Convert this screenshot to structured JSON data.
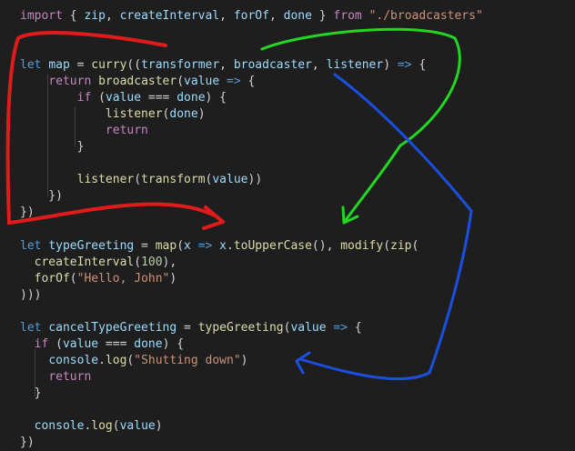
{
  "editor": {
    "theme_colors": {
      "background": "#1e1e1e",
      "keyword": "#569cd6",
      "control": "#c586c0",
      "function": "#dcdcaa",
      "variable": "#9cdcfe",
      "string": "#ce9178",
      "number": "#b5cea8",
      "punctuation": "#d4d4d4"
    },
    "lines": [
      {
        "tokens": [
          {
            "t": "import",
            "c": "ctl"
          },
          {
            "t": " { ",
            "c": "pun"
          },
          {
            "t": "zip",
            "c": "var"
          },
          {
            "t": ", ",
            "c": "pun"
          },
          {
            "t": "createInterval",
            "c": "var"
          },
          {
            "t": ", ",
            "c": "pun"
          },
          {
            "t": "forOf",
            "c": "var"
          },
          {
            "t": ", ",
            "c": "pun"
          },
          {
            "t": "done",
            "c": "var"
          },
          {
            "t": " } ",
            "c": "pun"
          },
          {
            "t": "from",
            "c": "ctl"
          },
          {
            "t": " ",
            "c": "pun"
          },
          {
            "t": "\"./broadcasters\"",
            "c": "str"
          }
        ]
      },
      {
        "tokens": []
      },
      {
        "tokens": []
      },
      {
        "tokens": [
          {
            "t": "let",
            "c": "kw"
          },
          {
            "t": " ",
            "c": "pun"
          },
          {
            "t": "map",
            "c": "var"
          },
          {
            "t": " = ",
            "c": "pun"
          },
          {
            "t": "curry",
            "c": "fn"
          },
          {
            "t": "((",
            "c": "pun"
          },
          {
            "t": "transformer",
            "c": "var"
          },
          {
            "t": ", ",
            "c": "pun"
          },
          {
            "t": "broadcaster",
            "c": "var"
          },
          {
            "t": ", ",
            "c": "pun"
          },
          {
            "t": "listener",
            "c": "var"
          },
          {
            "t": ") ",
            "c": "pun"
          },
          {
            "t": "=>",
            "c": "kw"
          },
          {
            "t": " {",
            "c": "pun"
          }
        ]
      },
      {
        "tokens": [
          {
            "t": "    ",
            "c": "pun"
          },
          {
            "t": "return",
            "c": "ctl"
          },
          {
            "t": " ",
            "c": "pun"
          },
          {
            "t": "broadcaster",
            "c": "fn"
          },
          {
            "t": "(",
            "c": "pun"
          },
          {
            "t": "value",
            "c": "var"
          },
          {
            "t": " ",
            "c": "pun"
          },
          {
            "t": "=>",
            "c": "kw"
          },
          {
            "t": " {",
            "c": "pun"
          }
        ]
      },
      {
        "tokens": [
          {
            "t": "        ",
            "c": "pun"
          },
          {
            "t": "if",
            "c": "ctl"
          },
          {
            "t": " (",
            "c": "pun"
          },
          {
            "t": "value",
            "c": "var"
          },
          {
            "t": " === ",
            "c": "pun"
          },
          {
            "t": "done",
            "c": "var"
          },
          {
            "t": ") {",
            "c": "pun"
          }
        ]
      },
      {
        "tokens": [
          {
            "t": "            ",
            "c": "pun"
          },
          {
            "t": "listener",
            "c": "fn"
          },
          {
            "t": "(",
            "c": "pun"
          },
          {
            "t": "done",
            "c": "var"
          },
          {
            "t": ")",
            "c": "pun"
          }
        ]
      },
      {
        "tokens": [
          {
            "t": "            ",
            "c": "pun"
          },
          {
            "t": "return",
            "c": "ctl"
          }
        ]
      },
      {
        "tokens": [
          {
            "t": "        }",
            "c": "pun"
          }
        ]
      },
      {
        "tokens": []
      },
      {
        "tokens": [
          {
            "t": "        ",
            "c": "pun"
          },
          {
            "t": "listener",
            "c": "fn"
          },
          {
            "t": "(",
            "c": "pun"
          },
          {
            "t": "transform",
            "c": "fn"
          },
          {
            "t": "(",
            "c": "pun"
          },
          {
            "t": "value",
            "c": "var"
          },
          {
            "t": "))",
            "c": "pun"
          }
        ]
      },
      {
        "tokens": [
          {
            "t": "    })",
            "c": "pun"
          }
        ]
      },
      {
        "tokens": [
          {
            "t": "})",
            "c": "pun"
          }
        ]
      },
      {
        "tokens": []
      },
      {
        "tokens": [
          {
            "t": "let",
            "c": "kw"
          },
          {
            "t": " ",
            "c": "pun"
          },
          {
            "t": "typeGreeting",
            "c": "var"
          },
          {
            "t": " = ",
            "c": "pun"
          },
          {
            "t": "map",
            "c": "fn"
          },
          {
            "t": "(",
            "c": "pun"
          },
          {
            "t": "x",
            "c": "var"
          },
          {
            "t": " ",
            "c": "pun"
          },
          {
            "t": "=>",
            "c": "kw"
          },
          {
            "t": " ",
            "c": "pun"
          },
          {
            "t": "x",
            "c": "var"
          },
          {
            "t": ".",
            "c": "pun"
          },
          {
            "t": "toUpperCase",
            "c": "fn"
          },
          {
            "t": "(), ",
            "c": "pun"
          },
          {
            "t": "modify",
            "c": "fn"
          },
          {
            "t": "(",
            "c": "pun"
          },
          {
            "t": "zip",
            "c": "fn"
          },
          {
            "t": "(",
            "c": "pun"
          }
        ]
      },
      {
        "tokens": [
          {
            "t": "  ",
            "c": "pun"
          },
          {
            "t": "createInterval",
            "c": "fn"
          },
          {
            "t": "(",
            "c": "pun"
          },
          {
            "t": "100",
            "c": "num"
          },
          {
            "t": "),",
            "c": "pun"
          }
        ]
      },
      {
        "tokens": [
          {
            "t": "  ",
            "c": "pun"
          },
          {
            "t": "forOf",
            "c": "fn"
          },
          {
            "t": "(",
            "c": "pun"
          },
          {
            "t": "\"Hello, John\"",
            "c": "str"
          },
          {
            "t": ")",
            "c": "pun"
          }
        ]
      },
      {
        "tokens": [
          {
            "t": ")))",
            "c": "pun"
          }
        ]
      },
      {
        "tokens": []
      },
      {
        "tokens": [
          {
            "t": "let",
            "c": "kw"
          },
          {
            "t": " ",
            "c": "pun"
          },
          {
            "t": "cancelTypeGreeting",
            "c": "var"
          },
          {
            "t": " = ",
            "c": "pun"
          },
          {
            "t": "typeGreeting",
            "c": "fn"
          },
          {
            "t": "(",
            "c": "pun"
          },
          {
            "t": "value",
            "c": "var"
          },
          {
            "t": " ",
            "c": "pun"
          },
          {
            "t": "=>",
            "c": "kw"
          },
          {
            "t": " {",
            "c": "pun"
          }
        ]
      },
      {
        "tokens": [
          {
            "t": "  ",
            "c": "pun"
          },
          {
            "t": "if",
            "c": "ctl"
          },
          {
            "t": " (",
            "c": "pun"
          },
          {
            "t": "value",
            "c": "var"
          },
          {
            "t": " === ",
            "c": "pun"
          },
          {
            "t": "done",
            "c": "var"
          },
          {
            "t": ") {",
            "c": "pun"
          }
        ]
      },
      {
        "tokens": [
          {
            "t": "    ",
            "c": "pun"
          },
          {
            "t": "console",
            "c": "var"
          },
          {
            "t": ".",
            "c": "pun"
          },
          {
            "t": "log",
            "c": "fn"
          },
          {
            "t": "(",
            "c": "pun"
          },
          {
            "t": "\"Shutting down\"",
            "c": "str"
          },
          {
            "t": ")",
            "c": "pun"
          }
        ]
      },
      {
        "tokens": [
          {
            "t": "    ",
            "c": "pun"
          },
          {
            "t": "return",
            "c": "ctl"
          }
        ]
      },
      {
        "tokens": [
          {
            "t": "  }",
            "c": "pun"
          }
        ]
      },
      {
        "tokens": []
      },
      {
        "tokens": [
          {
            "t": "  ",
            "c": "pun"
          },
          {
            "t": "console",
            "c": "var"
          },
          {
            "t": ".",
            "c": "pun"
          },
          {
            "t": "log",
            "c": "fn"
          },
          {
            "t": "(",
            "c": "pun"
          },
          {
            "t": "value",
            "c": "var"
          },
          {
            "t": ")",
            "c": "pun"
          }
        ]
      },
      {
        "tokens": [
          {
            "t": "})",
            "c": "pun"
          }
        ]
      }
    ]
  },
  "annotations": [
    {
      "name": "red-arrow",
      "color": "#e01b1b"
    },
    {
      "name": "green-arrow",
      "color": "#22d622"
    },
    {
      "name": "blue-arrow",
      "color": "#1a4fe0"
    }
  ]
}
